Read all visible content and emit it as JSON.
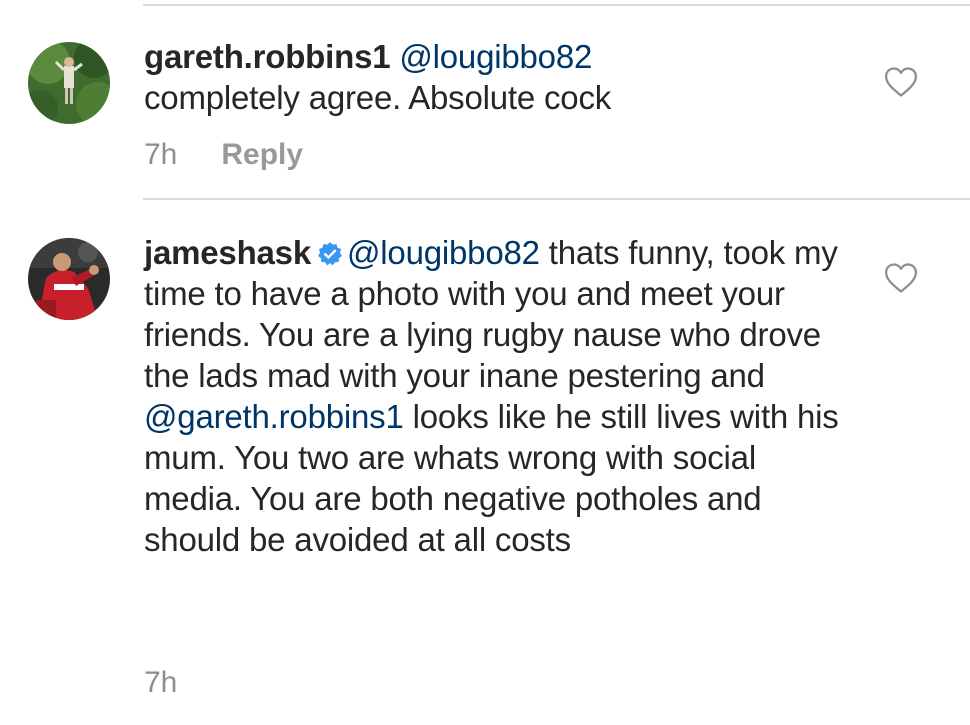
{
  "comments": [
    {
      "username": "gareth.robbins1",
      "mention": "@lougibbo82",
      "text": " completely agree. Absolute cock",
      "time": "7h",
      "reply_label": "Reply",
      "like_icon": "heart-outline-icon",
      "avatar_icon": "avatar-photo-outdoor"
    },
    {
      "username": "jameshask",
      "verified_icon": "verified-badge-icon",
      "mention": "@lougibbo82",
      "text_part1": " thats funny, took my time to have a photo with you and meet your friends. You are a lying rugby nause who drove the lads mad with your inane pestering and ",
      "mention2": "@gareth.robbins1",
      "text_part2": " looks like he still lives with his mum. You two are whats wrong with social media. You are both negative potholes and should be avoided at all costs",
      "time": "7h",
      "like_icon": "heart-outline-icon",
      "avatar_icon": "avatar-photo-rugby"
    }
  ],
  "colors": {
    "mention": "#003569",
    "verified": "#3897f0",
    "meta": "#8e8e8e",
    "divider": "#dbdbdb"
  }
}
